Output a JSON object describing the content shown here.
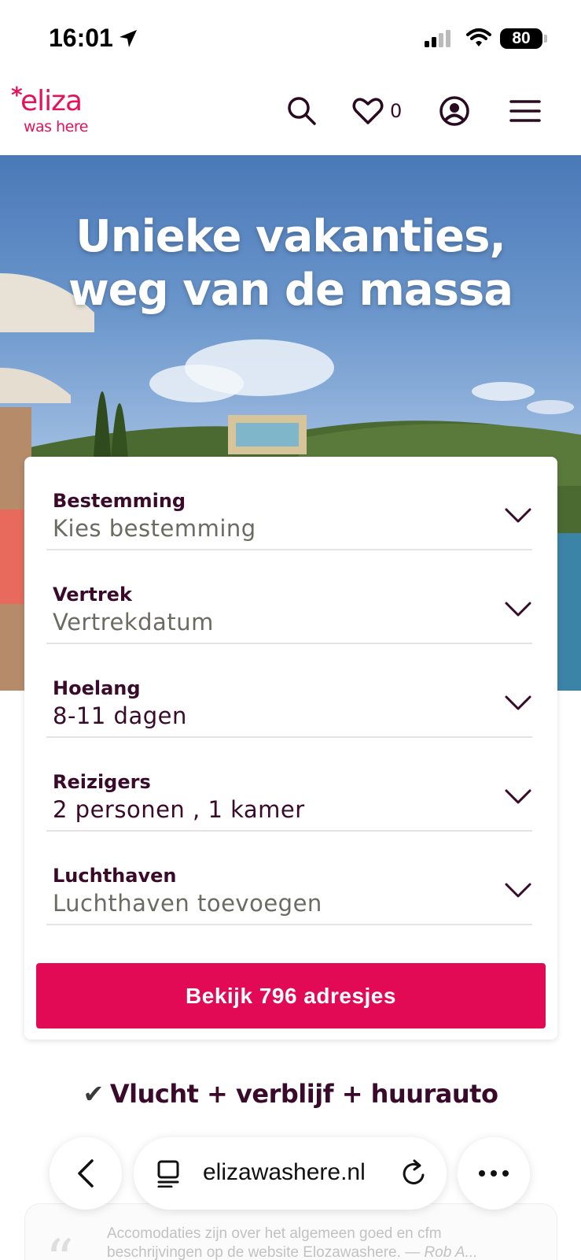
{
  "status_bar": {
    "time": "16:01",
    "battery": "80"
  },
  "header": {
    "logo_main": "eliza",
    "logo_star": "*",
    "logo_sub": "was here",
    "favorites_count": "0"
  },
  "hero": {
    "title_line1": "Unieke vakanties,",
    "title_line2": "weg van de massa"
  },
  "search_form": {
    "fields": [
      {
        "label": "Bestemming",
        "value": "Kies bestemming",
        "filled": false
      },
      {
        "label": "Vertrek",
        "value": "Vertrekdatum",
        "filled": false
      },
      {
        "label": "Hoelang",
        "value": "8-11 dagen",
        "filled": true
      },
      {
        "label": "Reizigers",
        "value": "2 personen , 1 kamer",
        "filled": true
      },
      {
        "label": "Luchthaven",
        "value": "Luchthaven toevoegen",
        "filled": false
      }
    ],
    "cta_label": "Bekijk 796 adresjes"
  },
  "feature": {
    "check": "✔",
    "text": "Vlucht + verblijf + huurauto"
  },
  "review": {
    "text": "Accomodaties zijn over het algemeen goed en cfm beschrijvingen op de website Elozawashere. —",
    "author": "Rob A..."
  },
  "browser": {
    "url": "elizawashere.nl"
  },
  "colors": {
    "brand": "#e30a55",
    "text": "#3a0a2a",
    "placeholder": "#6b6b62"
  }
}
